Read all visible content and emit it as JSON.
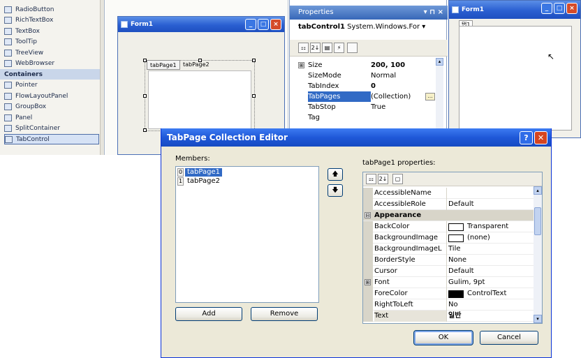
{
  "toolbox": {
    "items": [
      {
        "label": "RadioButton"
      },
      {
        "label": "RichTextBox"
      },
      {
        "label": "TextBox"
      },
      {
        "label": "ToolTip"
      },
      {
        "label": "TreeView"
      },
      {
        "label": "WebBrowser"
      }
    ],
    "section_header": "Containers",
    "container_items": [
      {
        "label": "Pointer"
      },
      {
        "label": "FlowLayoutPanel"
      },
      {
        "label": "GroupBox"
      },
      {
        "label": "Panel"
      },
      {
        "label": "SplitContainer"
      },
      {
        "label": "TabControl"
      }
    ],
    "selected_item": "TabControl"
  },
  "form1": {
    "title": "Form1",
    "tabs": [
      "tabPage1",
      "tabPage2"
    ]
  },
  "properties": {
    "title": "Properties",
    "title_buttons": "▾ ⊓ ×",
    "selected_object_name": "tabControl1",
    "selected_object_type": "System.Windows.For",
    "rows": [
      {
        "expander": "⊞",
        "name": "Size",
        "value": "200, 100"
      },
      {
        "name": "SizeMode",
        "value": "Normal"
      },
      {
        "name": "TabIndex",
        "value": "0"
      },
      {
        "name": "TabPages",
        "value": "(Collection)"
      },
      {
        "name": "TabStop",
        "value": "True"
      },
      {
        "name": "Tag",
        "value": ""
      }
    ],
    "toolbar_icons": [
      "categorized-icon",
      "alphabetical-icon",
      "property-pages-icon",
      "events-icon",
      "blank-icon"
    ]
  },
  "form2": {
    "title": "Form1",
    "tab_label": "탭1"
  },
  "dialog": {
    "title": "TabPage Collection Editor",
    "help_glyph": "?",
    "close_glyph": "✕",
    "members_label": "Members:",
    "members_access_key": "M",
    "members": [
      {
        "index": "0",
        "name": "tabPage1",
        "selected": true
      },
      {
        "index": "1",
        "name": "tabPage2",
        "selected": false
      }
    ],
    "move_up_glyph": "🡅",
    "move_down_glyph": "🡇",
    "add_button": "Add",
    "remove_button": "Remove",
    "properties_label": "tabPage1 properties:",
    "ok_button": "OK",
    "cancel_button": "Cancel",
    "grid_toolbar_glyphs": [
      "⚏",
      "2↓",
      "▢"
    ],
    "grid_rows": [
      {
        "name": "AccessibleName",
        "value": "",
        "kind": "prop"
      },
      {
        "name": "AccessibleRole",
        "value": "Default",
        "kind": "prop"
      },
      {
        "name": "Appearance",
        "value": "",
        "kind": "category",
        "expander": "⊟"
      },
      {
        "name": "BackColor",
        "value": "Transparent",
        "kind": "prop",
        "swatch": "#ffffff"
      },
      {
        "name": "BackgroundImage",
        "value": "(none)",
        "kind": "prop",
        "swatch": "#ffffff"
      },
      {
        "name": "BackgroundImageL",
        "value": "Tile",
        "kind": "prop"
      },
      {
        "name": "BorderStyle",
        "value": "None",
        "kind": "prop"
      },
      {
        "name": "Cursor",
        "value": "Default",
        "kind": "prop"
      },
      {
        "name": "Font",
        "value": "Gulim, 9pt",
        "kind": "prop",
        "expander": "⊞"
      },
      {
        "name": "ForeColor",
        "value": "ControlText",
        "kind": "prop",
        "swatch": "#000000"
      },
      {
        "name": "RightToLeft",
        "value": "No",
        "kind": "prop"
      },
      {
        "name": "Text",
        "value": "일반",
        "kind": "prop",
        "current": true
      }
    ],
    "scroll_up_glyph": "▴",
    "scroll_down_glyph": "▾"
  },
  "colors": {
    "xp_title_blue": "#2a5fd1",
    "selection_blue": "#316ac5",
    "dialog_face": "#ece9d8"
  }
}
